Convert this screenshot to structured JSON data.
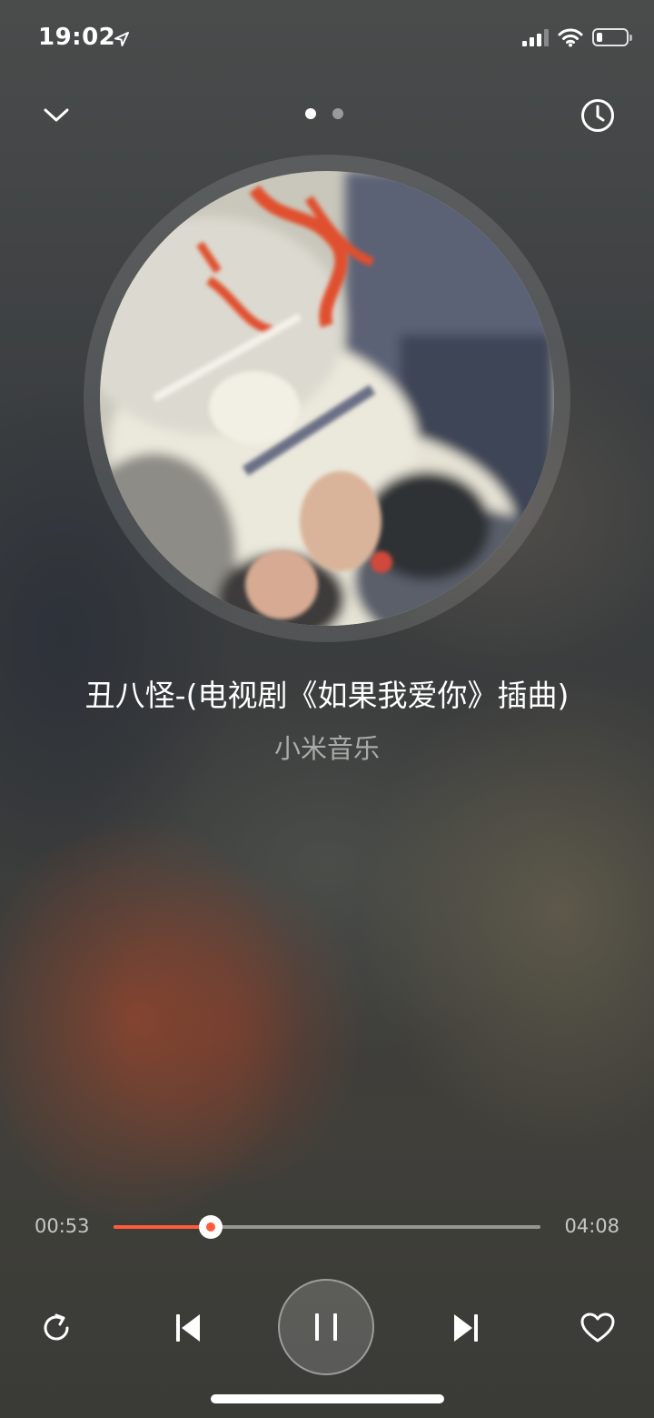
{
  "status_bar": {
    "time": "19:02",
    "icons": [
      "location-arrow-icon",
      "cellular-signal-icon",
      "wifi-icon",
      "battery-icon"
    ],
    "battery_level": 0.2
  },
  "nav": {
    "collapse_icon": "chevron-down-icon",
    "history_icon": "clock-icon",
    "page_count": 2,
    "active_page": 1
  },
  "song": {
    "title": "丑八怪-(电视剧《如果我爱你》插曲)",
    "artist": "小米音乐"
  },
  "player": {
    "current_time": "00:53",
    "total_time": "04:08",
    "progress": 0.227
  },
  "controls": {
    "repeat_icon": "repeat-icon",
    "previous_icon": "skip-previous-icon",
    "play_pause_icon": "pause-icon",
    "next_icon": "skip-next-icon",
    "favorite_icon": "heart-outline-icon"
  },
  "colors": {
    "accent": "#ff5a3c",
    "text": "#ffffff"
  }
}
